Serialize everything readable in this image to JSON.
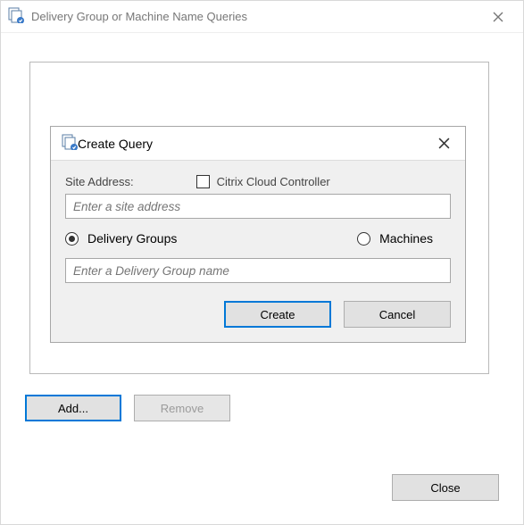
{
  "window": {
    "title": "Delivery Group or Machine Name Queries"
  },
  "buttons": {
    "add": "Add...",
    "remove": "Remove",
    "close": "Close"
  },
  "modal": {
    "title": "Create Query",
    "site_label": "Site Address:",
    "cloud_label": "Citrix Cloud Controller",
    "site_placeholder": "Enter a site address",
    "radio_delivery": "Delivery Groups",
    "radio_machines": "Machines",
    "name_placeholder": "Enter a Delivery Group name",
    "create": "Create",
    "cancel": "Cancel"
  }
}
